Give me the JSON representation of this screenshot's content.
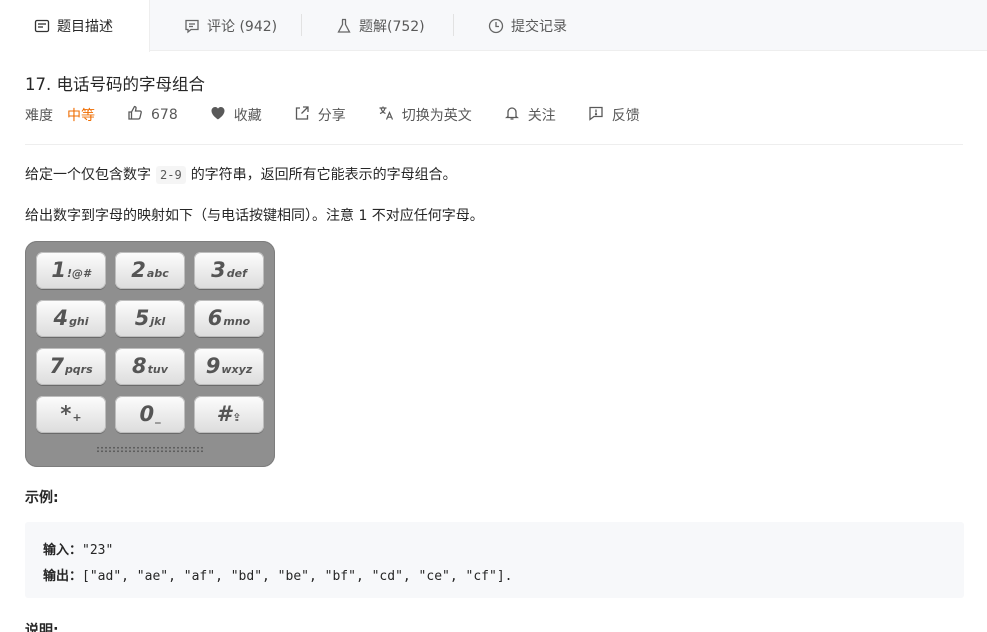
{
  "tabs": [
    {
      "label": "题目描述",
      "icon": "description-icon"
    },
    {
      "label": "评论 (942)",
      "icon": "comment-icon"
    },
    {
      "label": "题解(752)",
      "icon": "flask-icon"
    },
    {
      "label": "提交记录",
      "icon": "clock-icon"
    }
  ],
  "problem": {
    "title": "17. 电话号码的字母组合",
    "difficulty_label": "难度",
    "difficulty": "中等",
    "difficulty_color": "#ef6c00",
    "likes": "678",
    "favorite_label": "收藏",
    "share_label": "分享",
    "translate_label": "切换为英文",
    "follow_label": "关注",
    "feedback_label": "反馈"
  },
  "description": {
    "p1_before": "给定一个仅包含数字",
    "p1_code": "2-9",
    "p1_after": "的字符串，返回所有它能表示的字母组合。",
    "p2": "给出数字到字母的映射如下（与电话按键相同）。注意 1 不对应任何字母。"
  },
  "keypad": {
    "keys": [
      {
        "num": "1",
        "sub": "!@#"
      },
      {
        "num": "2",
        "sub": "abc"
      },
      {
        "num": "3",
        "sub": "def"
      },
      {
        "num": "4",
        "sub": "ghi"
      },
      {
        "num": "5",
        "sub": "jkl"
      },
      {
        "num": "6",
        "sub": "mno"
      },
      {
        "num": "7",
        "sub": "pqrs"
      },
      {
        "num": "8",
        "sub": "tuv"
      },
      {
        "num": "9",
        "sub": "wxyz"
      },
      {
        "num": "*",
        "sub": "+"
      },
      {
        "num": "0",
        "sub": "_"
      },
      {
        "num": "#",
        "sub": "⇪"
      }
    ]
  },
  "example": {
    "heading": "示例:",
    "input_label": "输入：",
    "input_value": "\"23\"",
    "output_label": "输出：",
    "output_value": "[\"ad\", \"ae\", \"af\", \"bd\", \"be\", \"bf\", \"cd\", \"ce\", \"cf\"]."
  },
  "note": {
    "heading": "说明:"
  }
}
